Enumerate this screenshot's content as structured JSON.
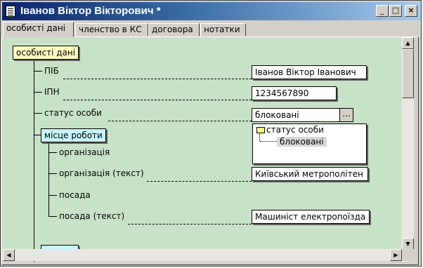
{
  "window": {
    "title": "Іванов Віктор Вікторович *",
    "minimize": "_",
    "maximize": "□",
    "close": "×"
  },
  "tabs": [
    {
      "label": "особисті дані"
    },
    {
      "label": "членство в КС"
    },
    {
      "label": "договора"
    },
    {
      "label": "нотатки"
    }
  ],
  "tree": {
    "root_label": "особисті дані",
    "fields": {
      "pib": {
        "label": "ПІБ",
        "value": "Іванов Віктор Іванович"
      },
      "ipn": {
        "label": "ІПН",
        "value": "1234567890"
      },
      "status": {
        "label": "статус особи",
        "value": "блоковані",
        "button": "..."
      },
      "workplace": {
        "label": "місце роботи",
        "org": {
          "label": "організація"
        },
        "org_text": {
          "label": "організація (текст)",
          "value": "Київський метрополітен"
        },
        "position": {
          "label": "посада"
        },
        "position_text": {
          "label": "посада (текст)",
          "value": "Машиніст електропоїзда"
        }
      }
    },
    "dropdown": {
      "root": "статус особи",
      "item": "блоковані"
    }
  },
  "colors": {
    "canvas": "#c8e2c8",
    "root_node": "#ffffc0",
    "workplace_node": "#c8f5ff",
    "selection": "#d8d8d8"
  }
}
